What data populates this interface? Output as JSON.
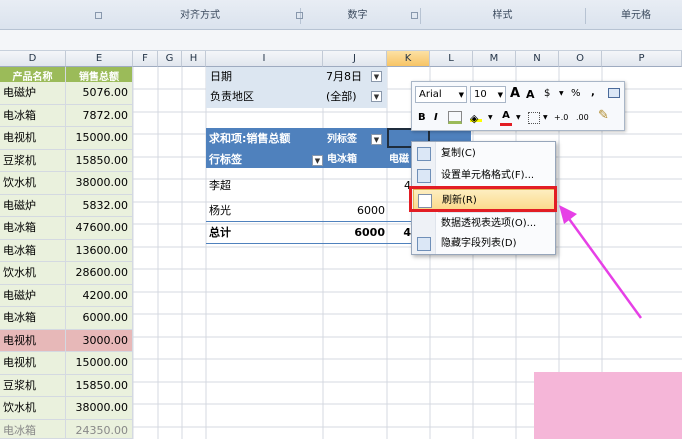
{
  "ribbon": {
    "groups": [
      "对齐方式",
      "数字",
      "样式",
      "单元格"
    ]
  },
  "sheet": {
    "columns": [
      "D",
      "E",
      "F",
      "G",
      "H",
      "I",
      "J",
      "K",
      "L",
      "M",
      "N",
      "O",
      "P"
    ],
    "header": {
      "product": "产品名称",
      "sales": "销售总额"
    },
    "rows": [
      {
        "product": "电磁炉",
        "sales": "5076.00"
      },
      {
        "product": "电冰箱",
        "sales": "7872.00"
      },
      {
        "product": "电视机",
        "sales": "15000.00"
      },
      {
        "product": "豆浆机",
        "sales": "15850.00"
      },
      {
        "product": "饮水机",
        "sales": "38000.00"
      },
      {
        "product": "电磁炉",
        "sales": "5832.00"
      },
      {
        "product": "电冰箱",
        "sales": "47600.00"
      },
      {
        "product": "电冰箱",
        "sales": "13600.00"
      },
      {
        "product": "饮水机",
        "sales": "28600.00"
      },
      {
        "product": "电磁炉",
        "sales": "4200.00"
      },
      {
        "product": "电冰箱",
        "sales": "6000.00"
      },
      {
        "product": "电视机",
        "sales": "3000.00"
      },
      {
        "product": "电视机",
        "sales": "15000.00"
      },
      {
        "product": "豆浆机",
        "sales": "15850.00"
      },
      {
        "product": "饮水机",
        "sales": "38000.00"
      },
      {
        "product": "电冰箱",
        "sales": "24350.00"
      }
    ]
  },
  "pivot": {
    "filter1_label": "日期",
    "filter1_value": "7月8日",
    "filter2_label": "负责地区",
    "filter2_value": "(全部)",
    "values_title": "求和项:销售总额",
    "col_labels": "列标签",
    "row_labels": "行标签",
    "col1": "电冰箱",
    "col2": "电磁",
    "rows": [
      {
        "label": "李超",
        "v1": "",
        "v2": "4"
      },
      {
        "label": "杨光",
        "v1": "6000",
        "v2": ""
      }
    ],
    "total_label": "总计",
    "total_v1": "6000",
    "total_v2": "4"
  },
  "mini_toolbar": {
    "font": "Arial",
    "size": "10",
    "grow": "A",
    "shrink": "A",
    "currency": "$",
    "percent": "%",
    "comma": ",",
    "bold": "B",
    "italic": "I",
    "font_color": "A",
    "inc_decimal": "+.0",
    "dec_decimal": ".00"
  },
  "context_menu": {
    "items": [
      "复制(C)",
      "设置单元格格式(F)...",
      "刷新(R)",
      "数据透视表选项(O)...",
      "隐藏字段列表(D)"
    ]
  },
  "colors": {
    "highlight": "#e21d24",
    "arrow": "#e640e6",
    "pink_corner": "#f5b6d8",
    "green_header": "#9bbb59"
  }
}
